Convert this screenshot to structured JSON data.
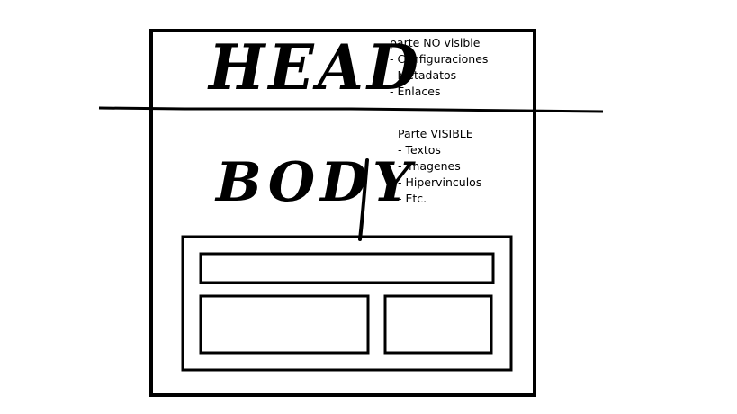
{
  "head": {
    "title": "HEAD",
    "note_heading": "parte NO visible",
    "items": [
      "- Configuraciones",
      "- Metadatos",
      "- Enlaces"
    ]
  },
  "body": {
    "title": "BODY",
    "note_heading": "Parte VISIBLE",
    "items": [
      "- Textos",
      "- Imagenes",
      "- Hipervinculos",
      "- Etc."
    ]
  }
}
